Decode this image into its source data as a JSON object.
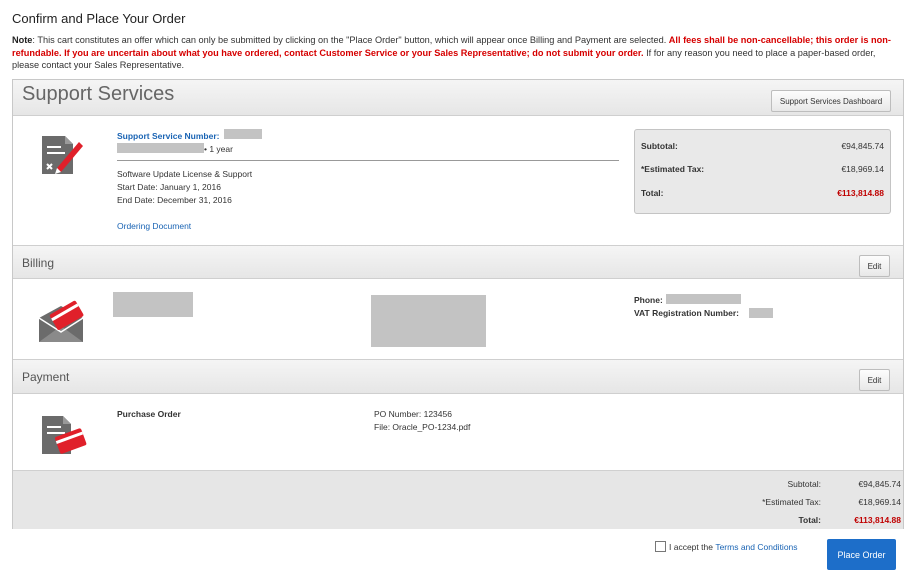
{
  "page": {
    "title": "Confirm and Place Your Order",
    "note_label": "Note",
    "note_text_1": ": This cart constitutes an offer which can only be submitted by clicking on the \"Place Order\" button, which will appear once Billing and Payment are selected. ",
    "note_red": "All fees shall be non-cancellable; this order is non-refundable. If you are uncertain about what you have ordered, contact Customer Service or your Sales Representative; do not submit your order.",
    "note_text_2": " If for any reason you need to place a paper-based order, please contact your Sales Representative."
  },
  "support": {
    "title": "Support Services",
    "dashboard_button": "Support Services Dashboard",
    "number_label": "Support Service Number:",
    "term": "• 1 year",
    "product": "Software Update License & Support",
    "start_date": "Start Date: January 1, 2016",
    "end_date": "End Date: December 31, 2016",
    "ordering_document": "Ordering Document",
    "summary": {
      "subtotal_label": "Subtotal:",
      "subtotal_value": "€94,845.74",
      "tax_label": "*Estimated Tax:",
      "tax_value": "€18,969.14",
      "total_label": "Total:",
      "total_value": "€113,814.88"
    }
  },
  "billing": {
    "title": "Billing",
    "edit": "Edit",
    "phone_label": "Phone:",
    "vat_label": "VAT Registration Number:"
  },
  "payment": {
    "title": "Payment",
    "edit": "Edit",
    "method": "Purchase Order",
    "po_number": "PO Number: 123456",
    "file": "File: Oracle_PO-1234.pdf"
  },
  "totals": {
    "subtotal_label": "Subtotal:",
    "subtotal_value": "€94,845.74",
    "tax_label": "*Estimated Tax:",
    "tax_value": "€18,969.14",
    "total_label": "Total:",
    "total_value": "€113,814.88"
  },
  "footer": {
    "accept_prefix": "I accept the ",
    "terms_link": "Terms and Conditions",
    "place_order": "Place Order"
  },
  "colors": {
    "accent_blue": "#1d6ec9",
    "total_red": "#c00000",
    "icon_red": "#e0202a",
    "icon_gray": "#6b6b6b"
  }
}
